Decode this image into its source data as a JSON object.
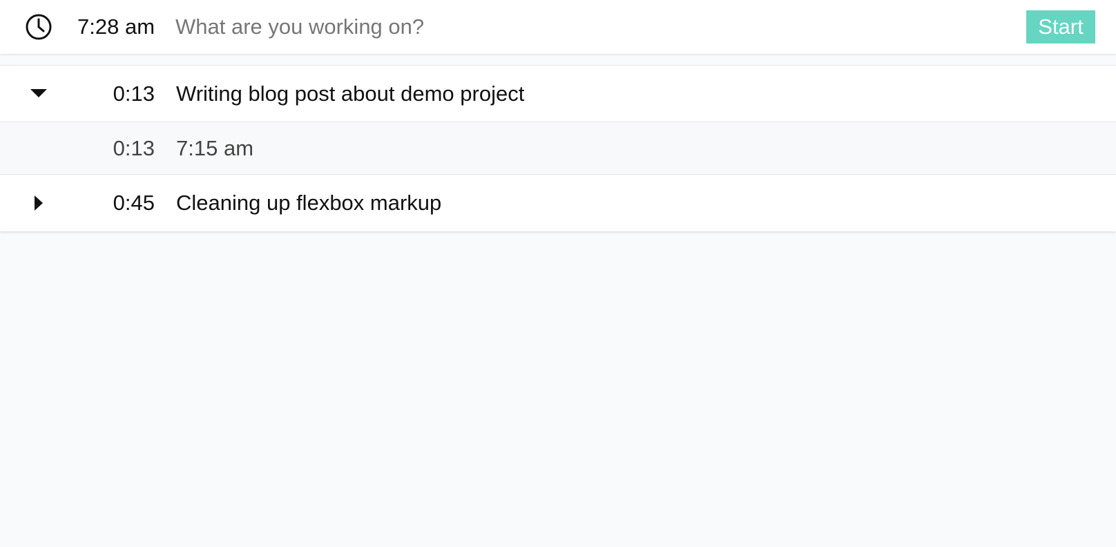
{
  "header": {
    "clock_icon": "clock-icon",
    "current_time": "7:28 am",
    "input_placeholder": "What are you working on?",
    "input_value": "",
    "start_label": "Start",
    "start_color": "#66d5c2"
  },
  "entries": [
    {
      "expanded": true,
      "toggle_icon": "caret-down-icon",
      "duration": "0:13",
      "title": "Writing blog post about demo project",
      "sessions": [
        {
          "duration": "0:13",
          "start_time": "7:15 am"
        }
      ]
    },
    {
      "expanded": false,
      "toggle_icon": "caret-right-icon",
      "duration": "0:45",
      "title": "Cleaning up flexbox markup",
      "sessions": []
    }
  ]
}
